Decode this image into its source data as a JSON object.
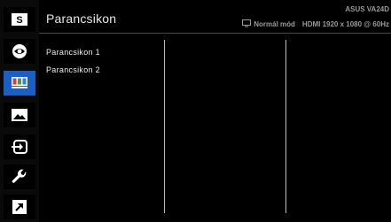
{
  "sidebar": {
    "items": [
      {
        "icon": "splendid-s-icon",
        "active": false
      },
      {
        "icon": "eye-care-icon",
        "active": false
      },
      {
        "icon": "color-bars-icon",
        "active": true
      },
      {
        "icon": "image-icon",
        "active": false
      },
      {
        "icon": "input-select-icon",
        "active": false
      },
      {
        "icon": "wrench-icon",
        "active": false
      },
      {
        "icon": "shortcut-arrow-icon",
        "active": false
      }
    ],
    "s_glyph": "S",
    "active_color": "#1b5fc4"
  },
  "header": {
    "title": "Parancsikon",
    "model": "ASUS VA24D",
    "mode": "Normál mód",
    "signal": "HDMI 1920 x 1080 @ 60Hz"
  },
  "menu": {
    "items": [
      "Parancsikon 1",
      "Parancsikon 2"
    ]
  }
}
